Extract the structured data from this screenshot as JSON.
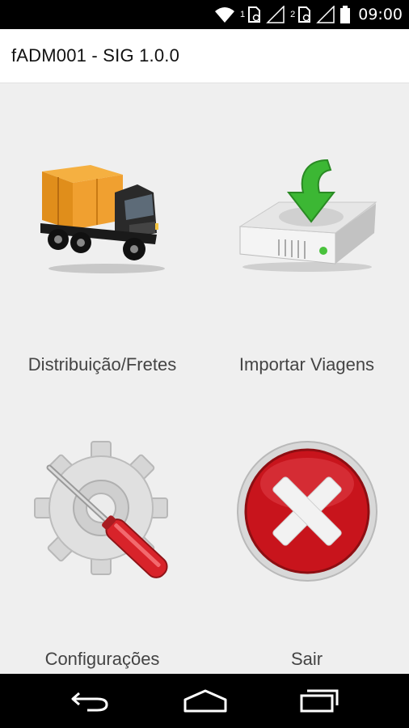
{
  "status_bar": {
    "sim1": "1",
    "sim2": "2",
    "time": "09:00",
    "icons": [
      "wifi-icon",
      "sim-1-icon",
      "signal-1-icon",
      "sim-2-icon",
      "signal-2-icon",
      "battery-icon"
    ]
  },
  "app": {
    "title": "fADM001 - SIG 1.0.0"
  },
  "menu": {
    "items": [
      {
        "label": "Distribuição/Fretes",
        "icon": "delivery-truck-icon"
      },
      {
        "label": "Importar Viagens",
        "icon": "download-drive-icon"
      },
      {
        "label": "Configurações",
        "icon": "settings-gear-wrench-icon"
      },
      {
        "label": "Sair",
        "icon": "exit-x-icon"
      }
    ]
  },
  "nav_bar": {
    "icons": [
      "back-icon",
      "home-icon",
      "recents-icon"
    ]
  },
  "colors": {
    "background": "#efefef",
    "action_bar": "#ffffff",
    "system_bars": "#000000",
    "label_text": "#444444"
  }
}
